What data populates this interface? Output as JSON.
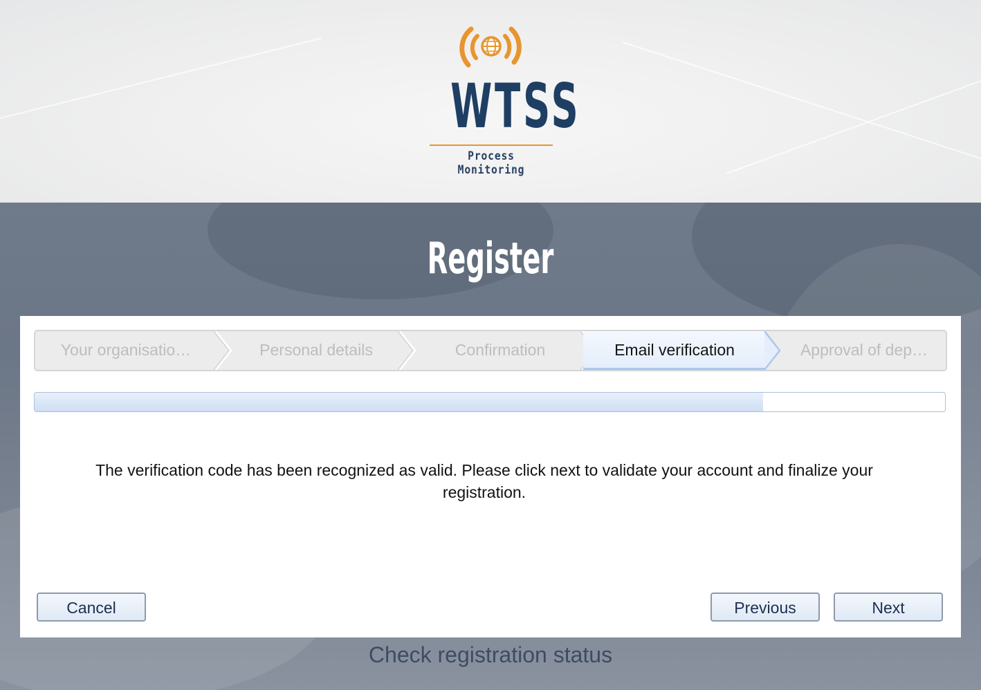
{
  "brand": {
    "name": "WTSS",
    "tagline": "Process Monitoring",
    "primary_color": "#1e3f63",
    "accent_color": "#e8952f"
  },
  "page": {
    "title": "Register"
  },
  "wizard": {
    "steps": [
      {
        "label": "Your organisatio…",
        "state": "disabled"
      },
      {
        "label": "Personal details",
        "state": "disabled"
      },
      {
        "label": "Confirmation",
        "state": "disabled"
      },
      {
        "label": "Email verification",
        "state": "active"
      },
      {
        "label": "Approval of dep…",
        "state": "disabled"
      }
    ],
    "progress_fraction": 0.8
  },
  "message": "The verification code has been recognized as valid. Please click next to validate your account and finalize your registration.",
  "buttons": {
    "cancel": "Cancel",
    "previous": "Previous",
    "next": "Next"
  },
  "links": {
    "check_status": "Check registration status"
  }
}
